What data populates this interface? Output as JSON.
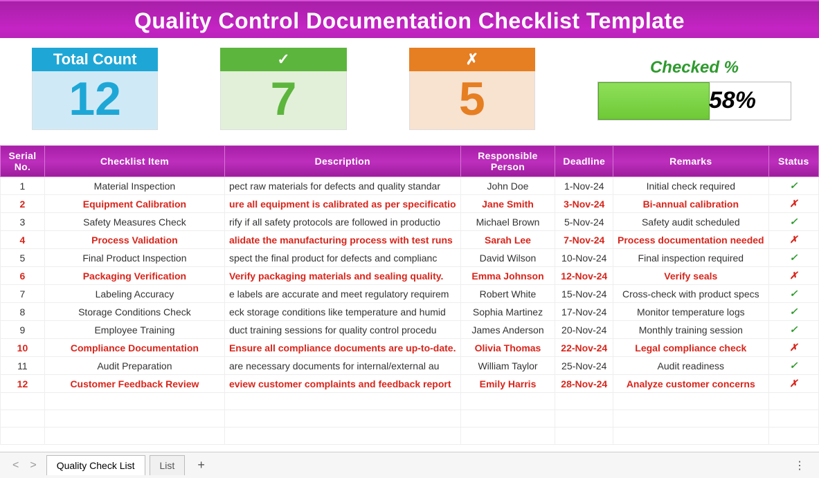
{
  "title": "Quality Control Documentation Checklist  Template",
  "stats": {
    "total_label": "Total Count",
    "total_value": "12",
    "check_label": "✓",
    "check_value": "7",
    "cross_label": "✗",
    "cross_value": "5",
    "checked_label": "Checked %",
    "checked_pct": "58%"
  },
  "columns": {
    "serial": "Serial No.",
    "item": "Checklist Item",
    "desc": "Description",
    "person": "Responsible Person",
    "deadline": "Deadline",
    "remarks": "Remarks",
    "status": "Status"
  },
  "rows": [
    {
      "serial": "1",
      "item": "Material Inspection",
      "desc": "pect raw materials for defects and quality standar",
      "person": "John Doe",
      "deadline": "1-Nov-24",
      "remarks": "Initial check required",
      "pass": true
    },
    {
      "serial": "2",
      "item": "Equipment Calibration",
      "desc": "ure all equipment is calibrated as per specificatio",
      "person": "Jane Smith",
      "deadline": "3-Nov-24",
      "remarks": "Bi-annual calibration",
      "pass": false
    },
    {
      "serial": "3",
      "item": "Safety Measures Check",
      "desc": "rify if all safety protocols are followed in productio",
      "person": "Michael Brown",
      "deadline": "5-Nov-24",
      "remarks": "Safety audit scheduled",
      "pass": true
    },
    {
      "serial": "4",
      "item": "Process Validation",
      "desc": "alidate the manufacturing process with test runs",
      "person": "Sarah Lee",
      "deadline": "7-Nov-24",
      "remarks": "Process documentation needed",
      "pass": false
    },
    {
      "serial": "5",
      "item": "Final Product Inspection",
      "desc": "spect the final product for defects and complianc",
      "person": "David Wilson",
      "deadline": "10-Nov-24",
      "remarks": "Final inspection required",
      "pass": true
    },
    {
      "serial": "6",
      "item": "Packaging Verification",
      "desc": "Verify packaging materials and sealing quality.",
      "person": "Emma Johnson",
      "deadline": "12-Nov-24",
      "remarks": "Verify seals",
      "pass": false
    },
    {
      "serial": "7",
      "item": "Labeling Accuracy",
      "desc": "e labels are accurate and meet regulatory requirem",
      "person": "Robert White",
      "deadline": "15-Nov-24",
      "remarks": "Cross-check with product specs",
      "pass": true
    },
    {
      "serial": "8",
      "item": "Storage Conditions Check",
      "desc": "eck storage conditions like temperature and humid",
      "person": "Sophia Martinez",
      "deadline": "17-Nov-24",
      "remarks": "Monitor temperature logs",
      "pass": true
    },
    {
      "serial": "9",
      "item": "Employee Training",
      "desc": "duct training sessions for quality control procedu",
      "person": "James Anderson",
      "deadline": "20-Nov-24",
      "remarks": "Monthly training session",
      "pass": true
    },
    {
      "serial": "10",
      "item": "Compliance Documentation",
      "desc": "Ensure all compliance documents are up-to-date.",
      "person": "Olivia Thomas",
      "deadline": "22-Nov-24",
      "remarks": "Legal compliance check",
      "pass": false
    },
    {
      "serial": "11",
      "item": "Audit Preparation",
      "desc": "are necessary documents for internal/external au",
      "person": "William Taylor",
      "deadline": "25-Nov-24",
      "remarks": "Audit readiness",
      "pass": true
    },
    {
      "serial": "12",
      "item": "Customer Feedback Review",
      "desc": "eview customer complaints and feedback report",
      "person": "Emily Harris",
      "deadline": "28-Nov-24",
      "remarks": "Analyze customer concerns",
      "pass": false
    }
  ],
  "tabs": {
    "active": "Quality Check List",
    "other": "List"
  }
}
